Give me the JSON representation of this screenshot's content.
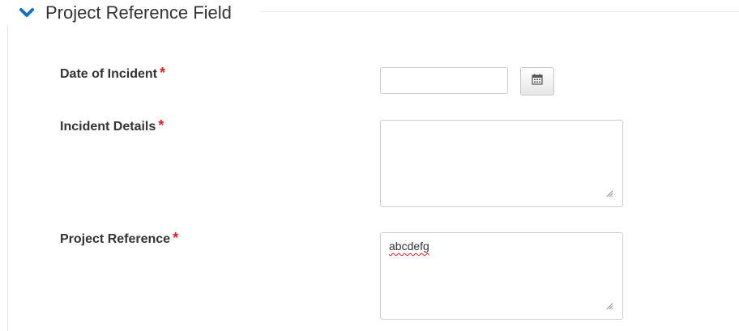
{
  "section": {
    "title": "Project Reference Field",
    "collapse_icon": "chevron-down-icon",
    "accent_color": "#0f74c0"
  },
  "form": {
    "required_marker": "*",
    "required_color": "#e31e24",
    "fields": [
      {
        "label": "Date of Incident",
        "type": "date",
        "value": "",
        "icon": "calendar-icon"
      },
      {
        "label": "Incident Details",
        "type": "textarea",
        "value": ""
      },
      {
        "label": "Project Reference",
        "type": "textarea",
        "value": "abcdefg"
      }
    ]
  }
}
